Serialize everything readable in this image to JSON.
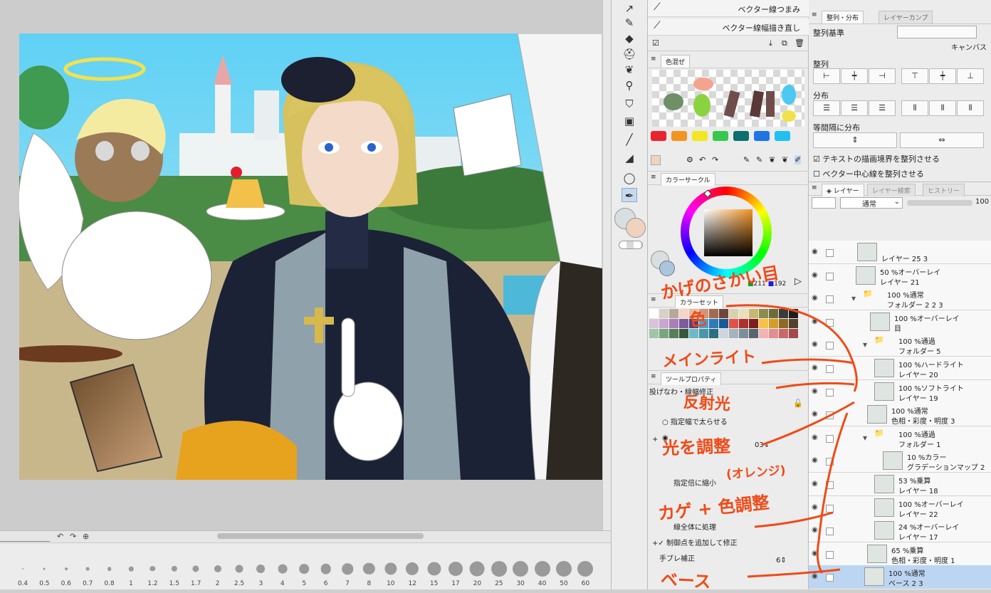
{
  "canvas": {
    "navigator_icons": [
      "rotate-left-icon",
      "rotate-right-icon",
      "reset-rotation-icon"
    ]
  },
  "brush_sizes": [
    "0.4",
    "0.5",
    "0.6",
    "0.7",
    "0.8",
    "1",
    "1.2",
    "1.5",
    "1.7",
    "2",
    "2.5",
    "3",
    "4",
    "5",
    "6",
    "7",
    "8",
    "10",
    "12",
    "15",
    "17",
    "20",
    "25",
    "30",
    "40",
    "50",
    "60"
  ],
  "sub_tools": {
    "items": [
      "ベクター線つまみ",
      "ベクター線幅描き直し"
    ]
  },
  "color_mix": {
    "tab": "色混ぜ"
  },
  "color_bar": [
    "#e8252e",
    "#f39321",
    "#f2e722",
    "#37c84f",
    "#0d6f6f",
    "#1f74e6",
    "#22c0f0"
  ],
  "color_circle": {
    "tab": "カラーサークル",
    "g": "211",
    "b": "192"
  },
  "color_set": {
    "tab": "カラーセット"
  },
  "tool_property": {
    "tab": "ツールプロパティ",
    "title": "投げなわ・線幅修正",
    "option_fatten": "指定幅で太らせる",
    "option_shrink": "指定倍に縮小",
    "process_whole": "線全体に処理",
    "add_control_points": "制御点を追加して修正",
    "stabilization_label": "手ブレ補正",
    "stabilization_value": "6",
    "width_value": "03"
  },
  "align_panel": {
    "tab_align": "整列・分布",
    "tab_comp": "レイヤーカンプ",
    "basis_label": "整列基準",
    "basis_value": "キャンバス",
    "align_label": "整列",
    "distribute_label": "分布",
    "equal_label": "等間隔に分布",
    "check_text_bounds": "テキストの描画境界を整列させる",
    "check_vector_center": "ベクター中心線を整列させる"
  },
  "layer_panel": {
    "tab_layer": "レイヤー",
    "tab_search": "レイヤー検索",
    "tab_history": "ヒストリー",
    "blend_mode": "通常",
    "opacity": "100",
    "layers": [
      {
        "l1": "",
        "l2": "レイヤー 25 3"
      },
      {
        "l1": "50 %オーバーレイ",
        "l2": "レイヤー 21"
      },
      {
        "l1": "100 %通常",
        "l2": "フォルダー 2 2 3"
      },
      {
        "l1": "100 %オーバーレイ",
        "l2": "目"
      },
      {
        "l1": "100 %通過",
        "l2": "フォルダー 5"
      },
      {
        "l1": "100 %ハードライト",
        "l2": "レイヤー 20"
      },
      {
        "l1": "100 %ソフトライト",
        "l2": "レイヤー 19"
      },
      {
        "l1": "100 %通常",
        "l2": "色相・彩度・明度 3"
      },
      {
        "l1": "100 %通過",
        "l2": "フォルダー 1"
      },
      {
        "l1": "10 %カラー",
        "l2": "グラデーションマップ 2"
      },
      {
        "l1": "53 %乗算",
        "l2": "レイヤー 18"
      },
      {
        "l1": "100 %オーバーレイ",
        "l2": "レイヤー 22"
      },
      {
        "l1": "24 %オーバーレイ",
        "l2": "レイヤー 17"
      },
      {
        "l1": "65 %乗算",
        "l2": "色相・彩度・明度 1"
      },
      {
        "l1": "100 %通常",
        "l2": "ベース 2 3"
      }
    ]
  },
  "annotations": {
    "shadow_color": "かげのさかい目",
    "shadow_color_2": "色",
    "main_light": "メインライト",
    "reflected_light": "反射光",
    "color_adjust": "光を調整",
    "orange": "(オレンジ)",
    "shadow_color_adjust": "カゲ + 色調整",
    "base": "ベース"
  }
}
